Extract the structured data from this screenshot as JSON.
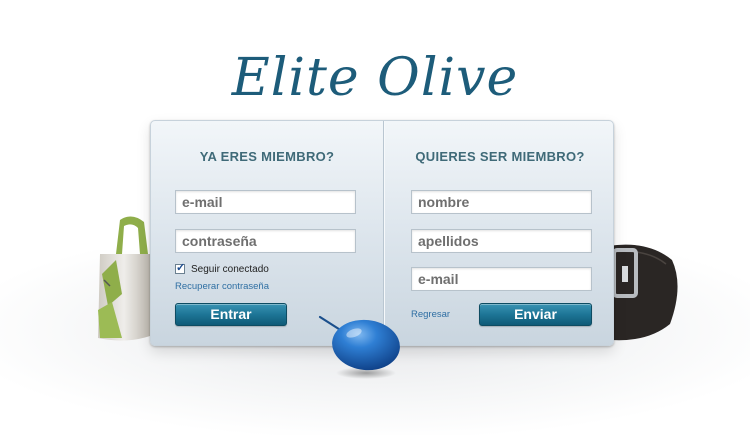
{
  "brand": {
    "logo_text": "Elite Olive",
    "logo_color": "#1d5c7a"
  },
  "login": {
    "title": "YA ERES MIEMBRO?",
    "email_placeholder": "e-mail",
    "password_placeholder": "contraseña",
    "remember_label": "Seguir conectado",
    "remember_checked": true,
    "recover_link": "Recuperar contraseña",
    "submit_label": "Entrar"
  },
  "register": {
    "title": "QUIERES SER MIEMBRO?",
    "name_placeholder": "nombre",
    "surname_placeholder": "apellidos",
    "email_placeholder": "e-mail",
    "back_link": "Regresar",
    "submit_label": "Enviar"
  },
  "colors": {
    "button": "#1d7596",
    "title": "#3f6a78",
    "link": "#2f6fa3",
    "olive": "#1f6fc4"
  },
  "icons": {
    "checkbox": "check-icon",
    "olive": "olive-icon",
    "bag": "handbag-icon",
    "belt": "belt-icon"
  }
}
